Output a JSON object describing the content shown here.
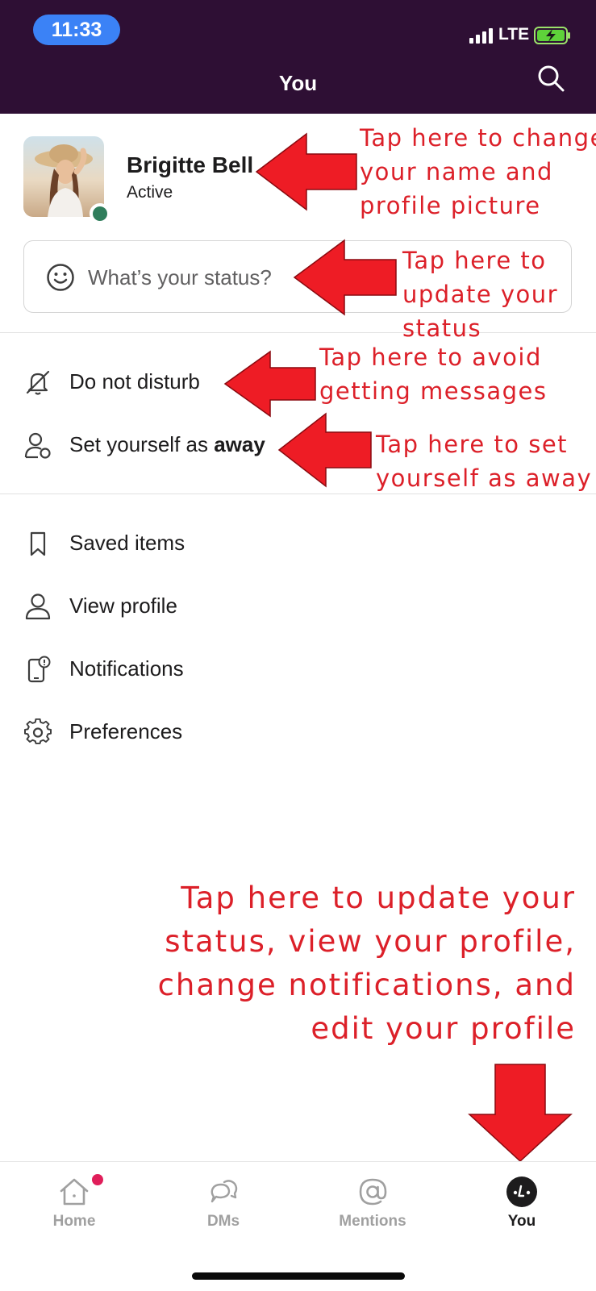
{
  "status_bar": {
    "time": "11:33",
    "network": "LTE"
  },
  "header": {
    "title": "You"
  },
  "profile": {
    "name": "Brigitte Bell",
    "presence": "Active"
  },
  "status_input": {
    "placeholder": "What’s your status?"
  },
  "presence_actions": [
    {
      "label": "Do not disturb"
    },
    {
      "label_prefix": "Set yourself as ",
      "label_bold": "away"
    }
  ],
  "menu_items": [
    {
      "label": "Saved items"
    },
    {
      "label": "View profile"
    },
    {
      "label": "Notifications"
    },
    {
      "label": "Preferences"
    }
  ],
  "annotations": {
    "profile": [
      "Tap here to change",
      "your name and",
      "profile picture"
    ],
    "status": [
      "Tap here to",
      "update your",
      "status"
    ],
    "dnd": [
      "Tap here to avoid",
      "getting messages"
    ],
    "away": [
      "Tap here to set",
      "yourself as away"
    ],
    "tab": [
      "Tap here to update your",
      "status, view your profile,",
      "change notifications, and",
      "edit your profile"
    ]
  },
  "tabbar": {
    "tabs": [
      {
        "label": "Home"
      },
      {
        "label": "DMs"
      },
      {
        "label": "Mentions"
      },
      {
        "label": "You"
      }
    ],
    "active_tab": "You"
  },
  "colors": {
    "header_bg": "#2e0f34",
    "annotation_red": "#dc2029",
    "online_green": "#2f7d5b",
    "badge_pink": "#e01e5a",
    "time_pill_blue": "#3b82f6"
  }
}
